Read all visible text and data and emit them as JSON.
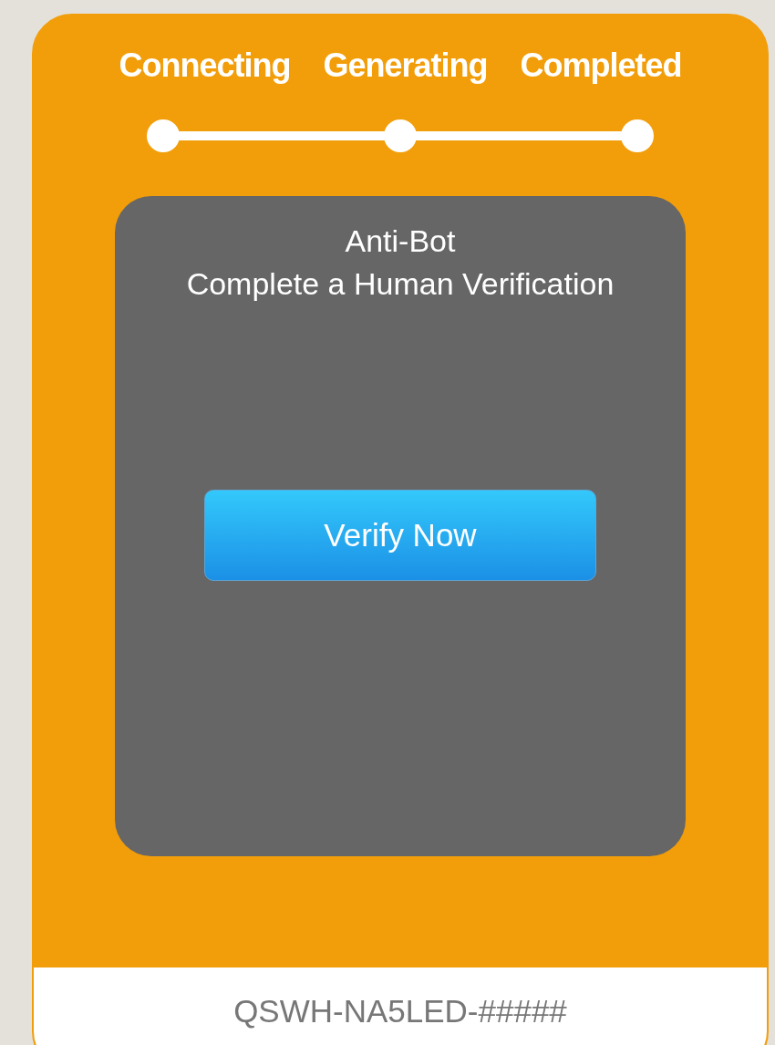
{
  "steps": [
    {
      "label": "Connecting"
    },
    {
      "label": "Generating"
    },
    {
      "label": "Completed"
    }
  ],
  "panel": {
    "title": "Anti-Bot",
    "subtitle": "Complete a Human Verification",
    "button": "Verify Now"
  },
  "footer": {
    "code": "QSWH-NA5LED-#####"
  }
}
